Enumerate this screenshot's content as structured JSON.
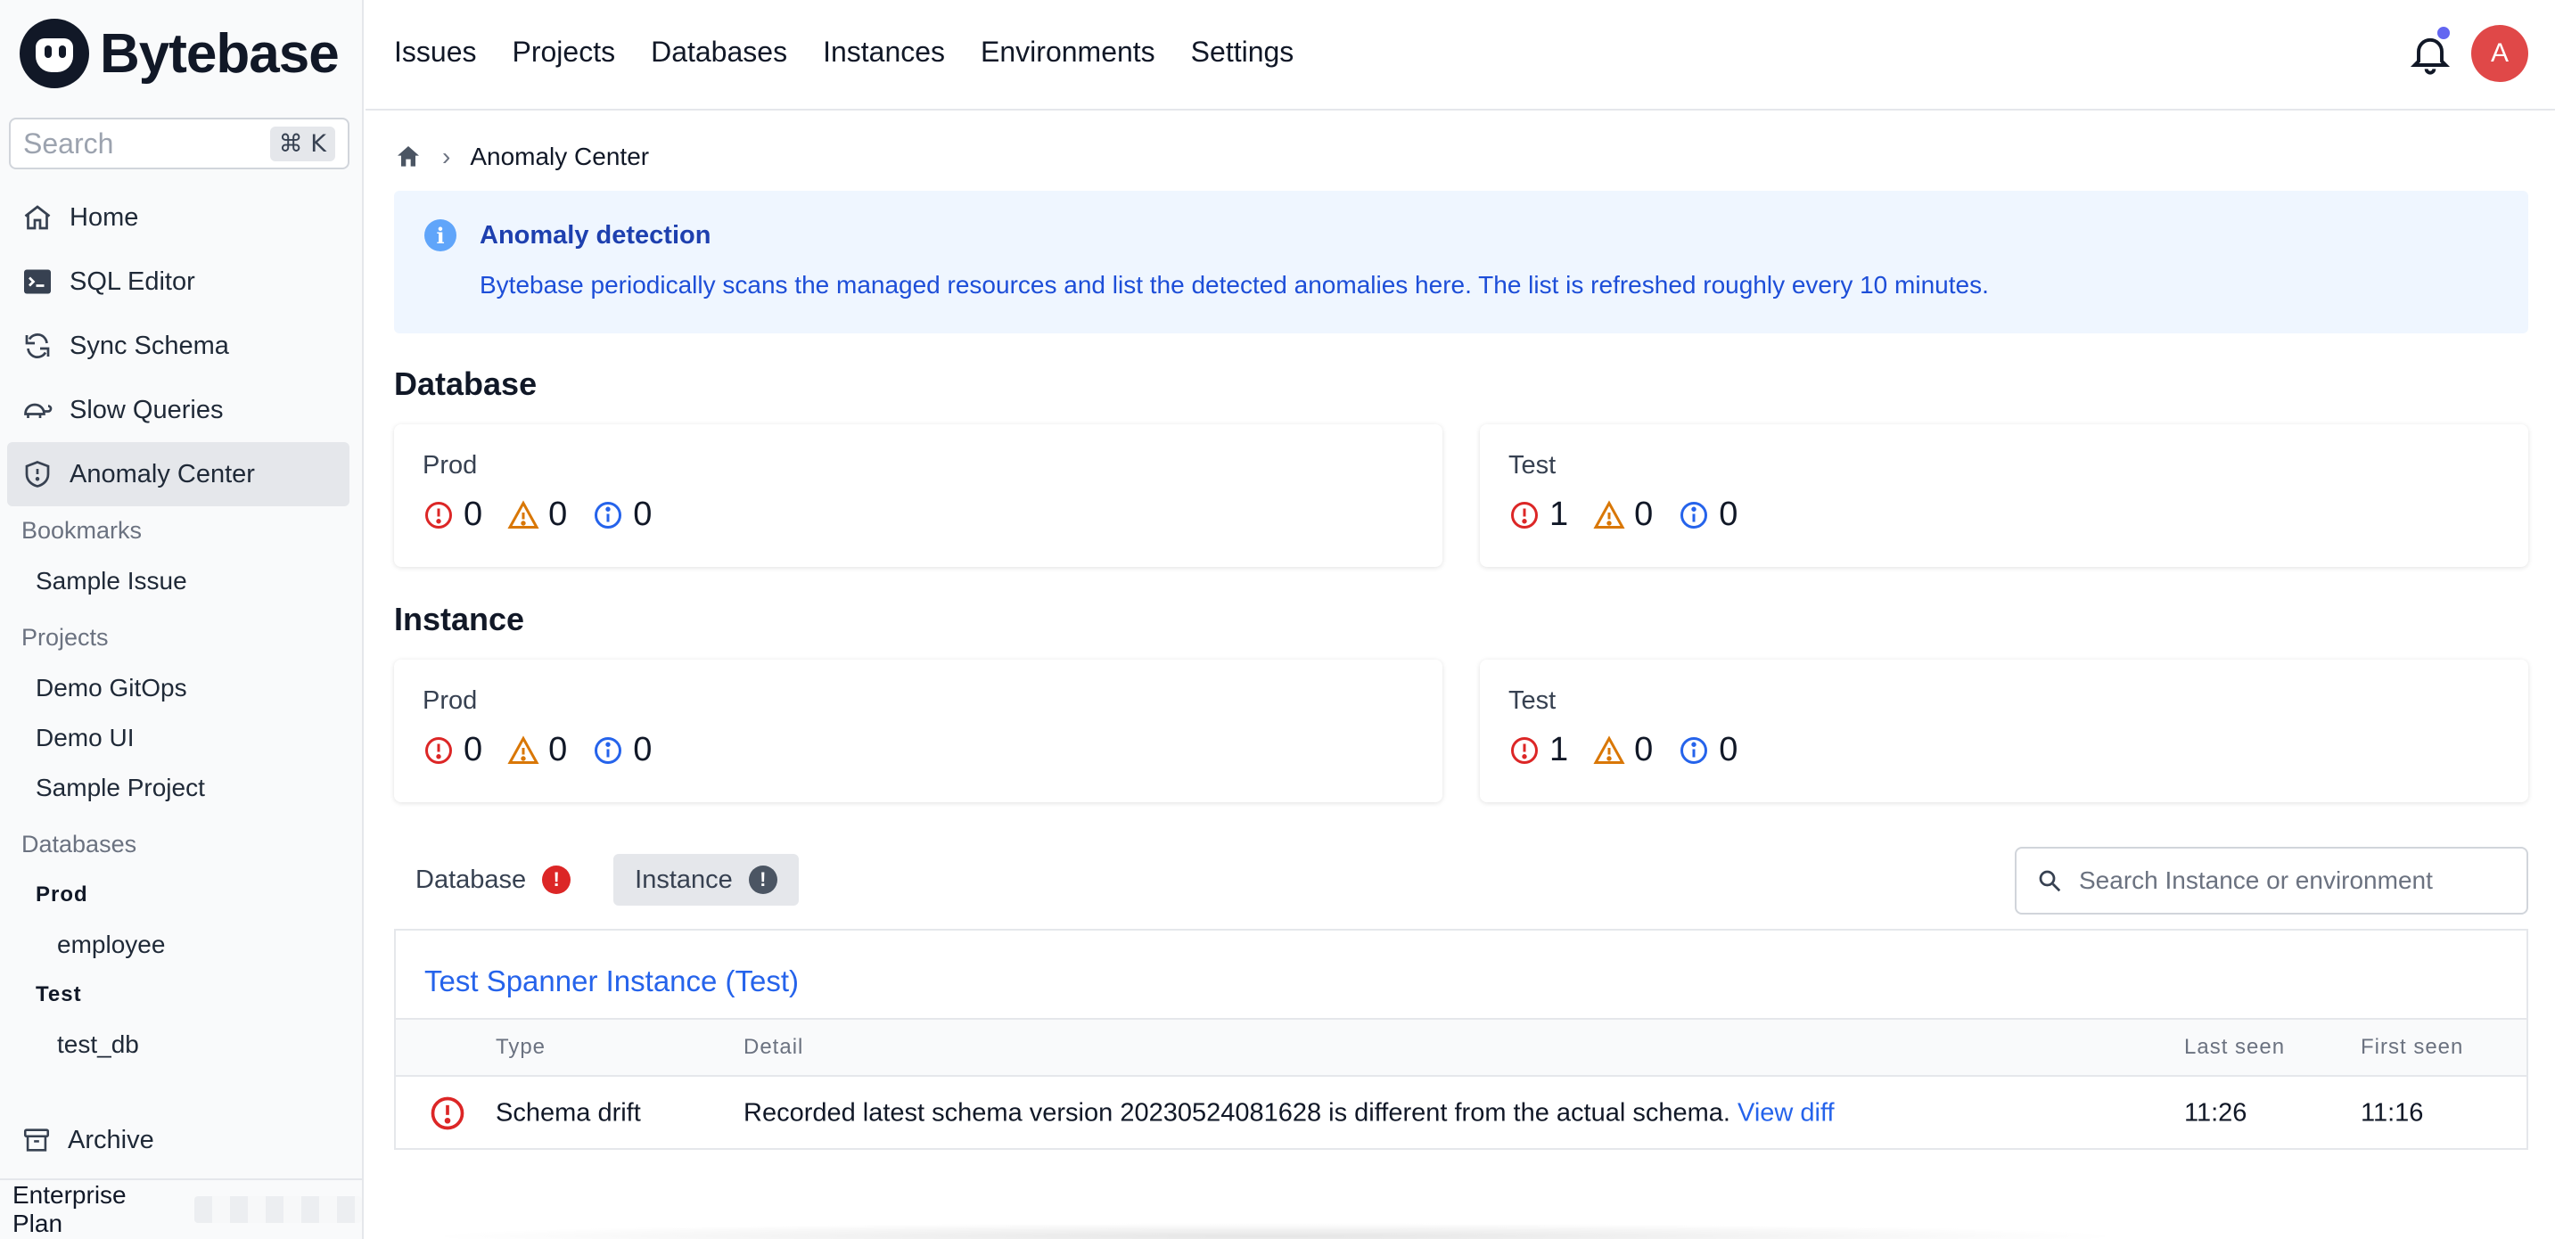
{
  "brand": {
    "name": "Bytebase"
  },
  "sidebar": {
    "search_placeholder": "Search",
    "search_shortcut": "⌘ K",
    "nav": [
      {
        "label": "Home",
        "icon": "home-icon"
      },
      {
        "label": "SQL Editor",
        "icon": "terminal-icon"
      },
      {
        "label": "Sync Schema",
        "icon": "refresh-icon"
      },
      {
        "label": "Slow Queries",
        "icon": "turtle-icon"
      },
      {
        "label": "Anomaly Center",
        "icon": "shield-icon",
        "active": true
      }
    ],
    "bookmarks_title": "Bookmarks",
    "bookmarks": [
      "Sample Issue"
    ],
    "projects_title": "Projects",
    "projects": [
      "Demo GitOps",
      "Demo UI",
      "Sample Project"
    ],
    "databases_title": "Databases",
    "database_groups": [
      {
        "name": "Prod",
        "items": [
          "employee"
        ]
      },
      {
        "name": "Test",
        "items": [
          "test_db"
        ]
      }
    ],
    "archive_label": "Archive",
    "plan_label": "Enterprise Plan"
  },
  "header": {
    "nav": [
      "Issues",
      "Projects",
      "Databases",
      "Instances",
      "Environments",
      "Settings"
    ],
    "avatar_initial": "A"
  },
  "breadcrumb": {
    "current": "Anomaly Center"
  },
  "alert": {
    "title": "Anomaly detection",
    "description": "Bytebase periodically scans the managed resources and list the detected anomalies here. The list is refreshed roughly every 10 minutes."
  },
  "database_section": {
    "title": "Database",
    "cards": [
      {
        "env": "Prod",
        "error": "0",
        "warning": "0",
        "info": "0"
      },
      {
        "env": "Test",
        "error": "1",
        "warning": "0",
        "info": "0"
      }
    ]
  },
  "instance_section": {
    "title": "Instance",
    "cards": [
      {
        "env": "Prod",
        "error": "0",
        "warning": "0",
        "info": "0"
      },
      {
        "env": "Test",
        "error": "1",
        "warning": "0",
        "info": "0"
      }
    ]
  },
  "tabs": [
    {
      "label": "Database",
      "active": false
    },
    {
      "label": "Instance",
      "active": true
    }
  ],
  "filter": {
    "placeholder": "Search Instance or environment"
  },
  "anomaly_table": {
    "instance_title": "Test Spanner Instance (Test)",
    "columns": {
      "type": "Type",
      "detail": "Detail",
      "last_seen": "Last seen",
      "first_seen": "First seen"
    },
    "rows": [
      {
        "type": "Schema drift",
        "detail": "Recorded latest schema version 20230524081628 is different from the actual schema.",
        "link": "View diff",
        "last_seen": "11:26",
        "first_seen": "11:16"
      }
    ]
  },
  "colors": {
    "error": "#dc2626",
    "warning": "#d97706",
    "info": "#2563eb",
    "link": "#2563eb",
    "alert_bg": "#eff6ff"
  }
}
